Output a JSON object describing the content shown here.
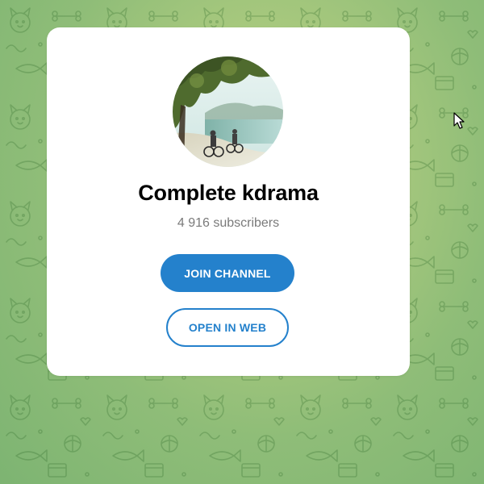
{
  "channel": {
    "title": "Complete kdrama",
    "subscribers": "4 916 subscribers"
  },
  "buttons": {
    "join_label": "JOIN CHANNEL",
    "web_label": "OPEN IN WEB"
  },
  "icons": {
    "background": "doodle-pattern-icon",
    "cursor": "mouse-pointer-icon"
  },
  "colors": {
    "accent": "#2481cc",
    "card": "#ffffff",
    "background_light": "#c4d68a",
    "background_dark": "#7db472",
    "subtitle": "#7a7a7a"
  }
}
